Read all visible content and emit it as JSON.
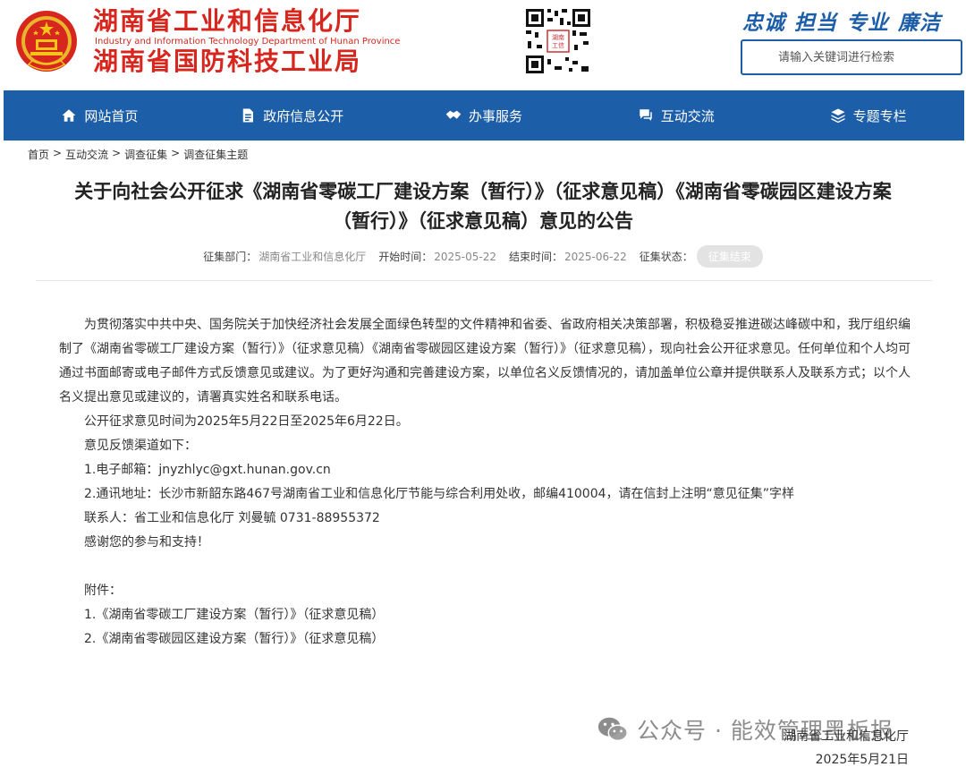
{
  "header": {
    "title_line1": "湖南省工业和信息化厅",
    "title_en": "Industry and Information Technology Department of Hunan Province",
    "title_line2": "湖南省国防科技工业局",
    "slogans": [
      "忠诚",
      "担当",
      "专业",
      "廉洁"
    ],
    "search_placeholder": "请输入关键词进行检索",
    "qr_center_text": "湖南\n工信"
  },
  "nav": {
    "items": [
      {
        "label": "网站首页",
        "icon": "home-icon"
      },
      {
        "label": "政府信息公开",
        "icon": "document-icon"
      },
      {
        "label": "办事服务",
        "icon": "handshake-icon"
      },
      {
        "label": "互动交流",
        "icon": "chat-icon"
      },
      {
        "label": "专题专栏",
        "icon": "layers-icon"
      }
    ]
  },
  "breadcrumb": [
    "首页",
    "互动交流",
    "调查征集",
    "调查征集主题"
  ],
  "breadcrumb_sep": ">",
  "article": {
    "title_line1": "关于向社会公开征求《湖南省零碳工厂建设方案（暂行）》（征求意见稿）《湖南省零碳园区建设方案",
    "title_line2": "（暂行）》（征求意见稿）意见的公告",
    "meta": {
      "dept_label": "征集部门：",
      "dept": "湖南省工业和信息化厅",
      "start_label": "开始时间：",
      "start": "2025-05-22",
      "end_label": "结束时间：",
      "end": "2025-06-22",
      "status_label": "征集状态：",
      "status": "征集结束"
    },
    "para1": "为贯彻落实中共中央、国务院关于加快经济社会发展全面绿色转型的文件精神和省委、省政府相关决策部署，积极稳妥推进碳达峰碳中和，我厅组织编制了《湖南省零碳工厂建设方案（暂行）》（征求意见稿）《湖南省零碳园区建设方案（暂行）》（征求意见稿），现向社会公开征求意见。任何单位和个人均可通过书面邮寄或电子邮件方式反馈意见或建议。为了更好沟通和完善建设方案，以单位名义反馈情况的，请加盖单位公章并提供联系人及联系方式；以个人名义提出意见或建议的，请署真实姓名和联系电话。",
    "para2": "公开征求意见时间为2025年5月22日至2025年6月22日。",
    "para3": "意见反馈渠道如下：",
    "para4": "1.电子邮箱：jnyzhlyc@gxt.hunan.gov.cn",
    "para5": "2.通讯地址：长沙市新韶东路467号湖南省工业和信息化厅节能与综合利用处收，邮编410004，请在信封上注明“意见征集”字样",
    "para6": "联系人：省工业和信息化厅 刘曼毓 0731-88955372",
    "para7": "感谢您的参与和支持！",
    "attach_label": "附件：",
    "attachments": [
      "1.《湖南省零碳工厂建设方案（暂行）》（征求意见稿）",
      "2.《湖南省零碳园区建设方案（暂行）》（征求意见稿）"
    ],
    "sign_org": "湖南省工业和信息化厅",
    "sign_date": "2025年5月21日"
  },
  "watermark": {
    "text": "公众号 · 能效管理黑板报"
  },
  "colors": {
    "brand_red": "#d7261e",
    "brand_blue": "#1d5ea8"
  }
}
